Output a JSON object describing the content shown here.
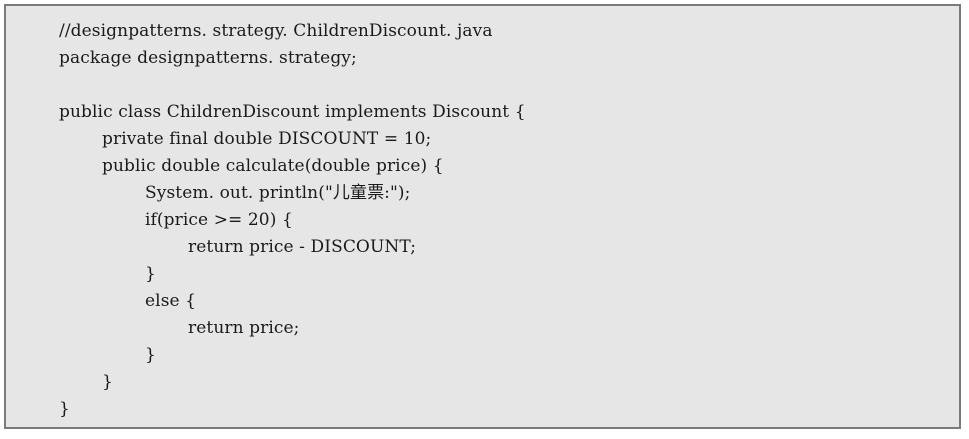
{
  "code": {
    "lines": [
      {
        "indent": 0,
        "text": "//designpatterns. strategy. ChildrenDiscount. java"
      },
      {
        "indent": 0,
        "text": "package designpatterns. strategy;"
      },
      {
        "indent": 0,
        "text": ""
      },
      {
        "indent": 0,
        "text": "public class ChildrenDiscount implements Discount {"
      },
      {
        "indent": 1,
        "text": "private final double DISCOUNT = 10;"
      },
      {
        "indent": 1,
        "text": "public double calculate(double price) {"
      },
      {
        "indent": 2,
        "text": "System. out. println(\"儿童票:\");"
      },
      {
        "indent": 2,
        "text": "if(price >= 20) {"
      },
      {
        "indent": 3,
        "text": "return price - DISCOUNT;"
      },
      {
        "indent": 2,
        "text": "}"
      },
      {
        "indent": 2,
        "text": "else {"
      },
      {
        "indent": 3,
        "text": "return price;"
      },
      {
        "indent": 2,
        "text": "}"
      },
      {
        "indent": 1,
        "text": "}"
      },
      {
        "indent": 0,
        "text": "}"
      }
    ]
  }
}
